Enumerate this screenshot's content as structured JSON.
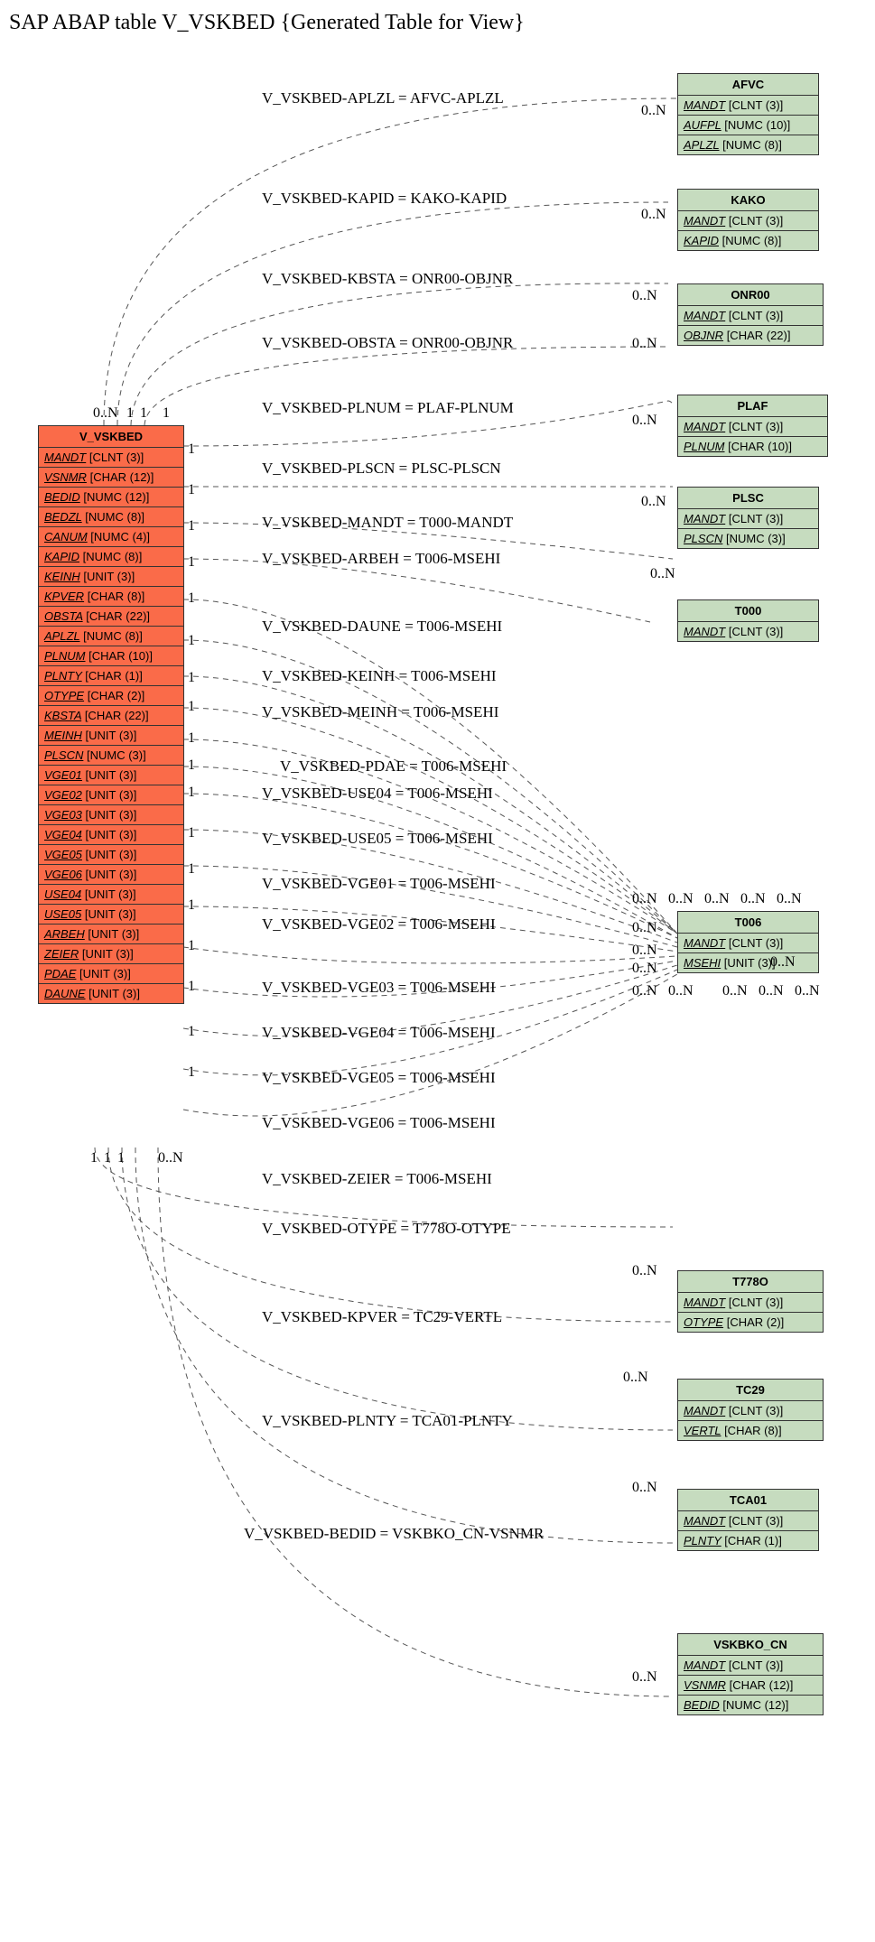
{
  "title": "SAP ABAP table V_VSKBED {Generated Table for View}",
  "main": {
    "name": "V_VSKBED",
    "fields": [
      {
        "name": "MANDT",
        "type": "[CLNT (3)]"
      },
      {
        "name": "VSNMR",
        "type": "[CHAR (12)]"
      },
      {
        "name": "BEDID",
        "type": "[NUMC (12)]"
      },
      {
        "name": "BEDZL",
        "type": "[NUMC (8)]"
      },
      {
        "name": "CANUM",
        "type": "[NUMC (4)]"
      },
      {
        "name": "KAPID",
        "type": "[NUMC (8)]"
      },
      {
        "name": "KEINH",
        "type": "[UNIT (3)]"
      },
      {
        "name": "KPVER",
        "type": "[CHAR (8)]"
      },
      {
        "name": "OBSTA",
        "type": "[CHAR (22)]"
      },
      {
        "name": "APLZL",
        "type": "[NUMC (8)]"
      },
      {
        "name": "PLNUM",
        "type": "[CHAR (10)]"
      },
      {
        "name": "PLNTY",
        "type": "[CHAR (1)]"
      },
      {
        "name": "OTYPE",
        "type": "[CHAR (2)]"
      },
      {
        "name": "KBSTA",
        "type": "[CHAR (22)]"
      },
      {
        "name": "MEINH",
        "type": "[UNIT (3)]"
      },
      {
        "name": "PLSCN",
        "type": "[NUMC (3)]"
      },
      {
        "name": "VGE01",
        "type": "[UNIT (3)]"
      },
      {
        "name": "VGE02",
        "type": "[UNIT (3)]"
      },
      {
        "name": "VGE03",
        "type": "[UNIT (3)]"
      },
      {
        "name": "VGE04",
        "type": "[UNIT (3)]"
      },
      {
        "name": "VGE05",
        "type": "[UNIT (3)]"
      },
      {
        "name": "VGE06",
        "type": "[UNIT (3)]"
      },
      {
        "name": "USE04",
        "type": "[UNIT (3)]"
      },
      {
        "name": "USE05",
        "type": "[UNIT (3)]"
      },
      {
        "name": "ARBEH",
        "type": "[UNIT (3)]"
      },
      {
        "name": "ZEIER",
        "type": "[UNIT (3)]"
      },
      {
        "name": "PDAE",
        "type": "[UNIT (3)]"
      },
      {
        "name": "DAUNE",
        "type": "[UNIT (3)]"
      }
    ]
  },
  "refs": [
    {
      "id": "afvc",
      "name": "AFVC",
      "fields": [
        {
          "name": "MANDT",
          "type": "[CLNT (3)]"
        },
        {
          "name": "AUFPL",
          "type": "[NUMC (10)]"
        },
        {
          "name": "APLZL",
          "type": "[NUMC (8)]"
        }
      ]
    },
    {
      "id": "kako",
      "name": "KAKO",
      "fields": [
        {
          "name": "MANDT",
          "type": "[CLNT (3)]"
        },
        {
          "name": "KAPID",
          "type": "[NUMC (8)]"
        }
      ]
    },
    {
      "id": "onr00",
      "name": "ONR00",
      "fields": [
        {
          "name": "MANDT",
          "type": "[CLNT (3)]"
        },
        {
          "name": "OBJNR",
          "type": "[CHAR (22)]"
        }
      ]
    },
    {
      "id": "plaf",
      "name": "PLAF",
      "fields": [
        {
          "name": "MANDT",
          "type": "[CLNT (3)]"
        },
        {
          "name": "PLNUM",
          "type": "[CHAR (10)]"
        }
      ]
    },
    {
      "id": "plsc",
      "name": "PLSC",
      "fields": [
        {
          "name": "MANDT",
          "type": "[CLNT (3)]"
        },
        {
          "name": "PLSCN",
          "type": "[NUMC (3)]"
        }
      ]
    },
    {
      "id": "t000",
      "name": "T000",
      "fields": [
        {
          "name": "MANDT",
          "type": "[CLNT (3)]"
        }
      ]
    },
    {
      "id": "t006",
      "name": "T006",
      "fields": [
        {
          "name": "MANDT",
          "type": "[CLNT (3)]"
        },
        {
          "name": "MSEHI",
          "type": "[UNIT (3)]"
        }
      ]
    },
    {
      "id": "t778o",
      "name": "T778O",
      "fields": [
        {
          "name": "MANDT",
          "type": "[CLNT (3)]"
        },
        {
          "name": "OTYPE",
          "type": "[CHAR (2)]"
        }
      ]
    },
    {
      "id": "tc29",
      "name": "TC29",
      "fields": [
        {
          "name": "MANDT",
          "type": "[CLNT (3)]"
        },
        {
          "name": "VERTL",
          "type": "[CHAR (8)]"
        }
      ]
    },
    {
      "id": "tca01",
      "name": "TCA01",
      "fields": [
        {
          "name": "MANDT",
          "type": "[CLNT (3)]"
        },
        {
          "name": "PLNTY",
          "type": "[CHAR (1)]"
        }
      ]
    },
    {
      "id": "vskbko_cn",
      "name": "VSKBKO_CN",
      "fields": [
        {
          "name": "MANDT",
          "type": "[CLNT (3)]"
        },
        {
          "name": "VSNMR",
          "type": "[CHAR (12)]"
        },
        {
          "name": "BEDID",
          "type": "[NUMC (12)]"
        }
      ]
    }
  ],
  "relations": [
    {
      "label": "V_VSKBED-APLZL = AFVC-APLZL"
    },
    {
      "label": "V_VSKBED-KAPID = KAKO-KAPID"
    },
    {
      "label": "V_VSKBED-KBSTA = ONR00-OBJNR"
    },
    {
      "label": "V_VSKBED-OBSTA = ONR00-OBJNR"
    },
    {
      "label": "V_VSKBED-PLNUM = PLAF-PLNUM"
    },
    {
      "label": "V_VSKBED-PLSCN = PLSC-PLSCN"
    },
    {
      "label": "V_VSKBED-MANDT = T000-MANDT"
    },
    {
      "label": "V_VSKBED-ARBEH = T006-MSEHI"
    },
    {
      "label": "V_VSKBED-DAUNE = T006-MSEHI"
    },
    {
      "label": "V_VSKBED-KEINH = T006-MSEHI"
    },
    {
      "label": "V_VSKBED-MEINH = T006-MSEHI"
    },
    {
      "label": "V_VSKBED-PDAE = T006-MSEHI"
    },
    {
      "label": "V_VSKBED-USE04 = T006-MSEHI"
    },
    {
      "label": "V_VSKBED-USE05 = T006-MSEHI"
    },
    {
      "label": "V_VSKBED-VGE01 = T006-MSEHI"
    },
    {
      "label": "V_VSKBED-VGE02 = T006-MSEHI"
    },
    {
      "label": "V_VSKBED-VGE03 = T006-MSEHI"
    },
    {
      "label": "V_VSKBED-VGE04 = T006-MSEHI"
    },
    {
      "label": "V_VSKBED-VGE05 = T006-MSEHI"
    },
    {
      "label": "V_VSKBED-VGE06 = T006-MSEHI"
    },
    {
      "label": "V_VSKBED-ZEIER = T006-MSEHI"
    },
    {
      "label": "V_VSKBED-OTYPE = T778O-OTYPE"
    },
    {
      "label": "V_VSKBED-KPVER = TC29-VERTL"
    },
    {
      "label": "V_VSKBED-PLNTY = TCA01-PLNTY"
    },
    {
      "label": "V_VSKBED-BEDID = VSKBKO_CN-VSNMR"
    }
  ],
  "cards": {
    "top0N": "0..N",
    "top1a": "1",
    "top1b": "1",
    "top1c": "1",
    "bot1a": "1",
    "bot1b": "1",
    "bot1c": "1",
    "bot0N": "0..N",
    "side": [
      "1",
      "1",
      "1",
      "1",
      "1",
      "1",
      "1",
      "1",
      "1",
      "1",
      "1",
      "1",
      "1",
      "1",
      "1",
      "1",
      "1",
      "1"
    ],
    "r0n_a": "0..N",
    "r0n_b": "0..N",
    "r0n_c": "0..N",
    "r0n_d": "0..N",
    "r0n_e": "0..N",
    "r0n_f": "0..N",
    "r0n_g": "0..N",
    "r0n_t778o": "0..N",
    "r0n_tc29": "0..N",
    "r0n_tca01": "0..N",
    "r0n_vskbko": "0..N",
    "t006_cluster_a": "0..N",
    "t006_cluster_b": "0..N",
    "t006_cluster_c": "0..N",
    "t006_cluster_d": "0..N",
    "t006_cluster_e": "0..N",
    "t006_cluster_f": "0..N",
    "t006_cluster_h": "0..N",
    "t006_cluster_i": "0..N",
    "t006_cluster_j": "0..N",
    "t006_cluster_k": "0..N",
    "t006_cluster_l": "0..N",
    "t006_cluster_m": "0..N",
    "t006_cluster_n": "0..N",
    "t006_cluster_o": "0..N"
  }
}
